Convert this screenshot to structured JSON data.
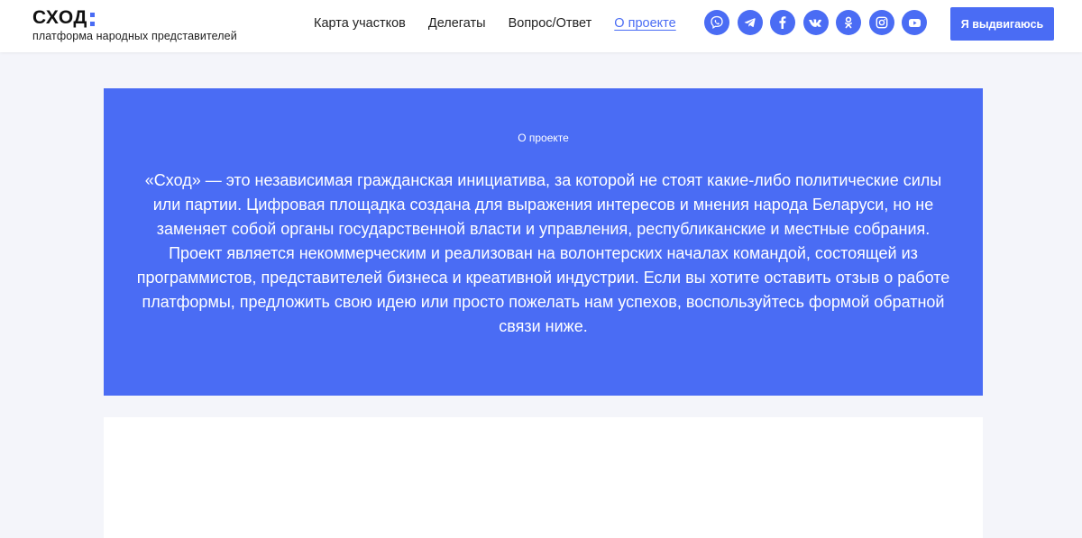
{
  "brand": {
    "name": "СХОД",
    "tagline": "платформа народных представителей",
    "accent_color": "#4a6cf4"
  },
  "nav": {
    "items": [
      {
        "label": "Карта участков",
        "active": false
      },
      {
        "label": "Делегаты",
        "active": false
      },
      {
        "label": "Вопрос/Ответ",
        "active": false
      },
      {
        "label": "О проекте",
        "active": true
      }
    ]
  },
  "socials": [
    {
      "icon": "viber-icon"
    },
    {
      "icon": "telegram-icon"
    },
    {
      "icon": "facebook-icon"
    },
    {
      "icon": "vk-icon"
    },
    {
      "icon": "odnoklassniki-icon"
    },
    {
      "icon": "instagram-icon"
    },
    {
      "icon": "youtube-icon"
    }
  ],
  "cta": {
    "label": "Я выдвигаюсь"
  },
  "about": {
    "label": "О проекте",
    "text": "«Сход» — это независимая гражданская инициатива, за которой не стоят какие-либо политические силы или партии. Цифровая площадка создана для выражения интересов и мнения народа Беларуси, но не заменяет собой органы государственной власти и управления, республиканские и местные собрания. Проект является некоммерческим и реализован на волонтерских началах командой, состоящей из программистов, представителей бизнеса и креативной индустрии. Если вы хотите оставить отзыв о работе платформы, предложить свою идею или просто пожелать нам успехов, воспользуйтесь формой обратной связи ниже."
  }
}
